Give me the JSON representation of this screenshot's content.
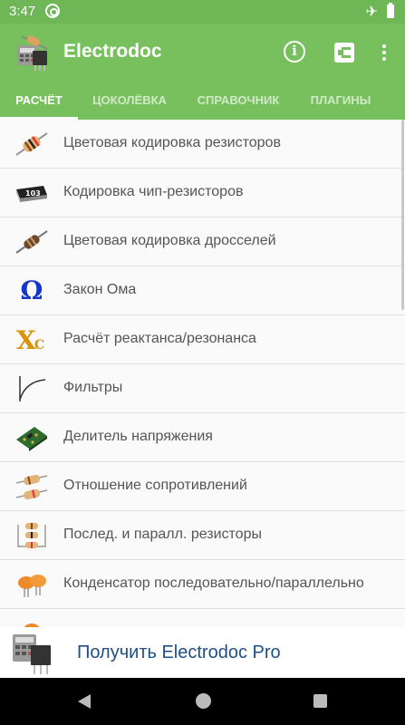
{
  "status_bar": {
    "time": "3:47"
  },
  "app": {
    "title": "Electrodoc"
  },
  "tabs": [
    {
      "label": "РАСЧЁТ",
      "active": true
    },
    {
      "label": "ЦОКОЛЁВКА",
      "active": false
    },
    {
      "label": "СПРАВОЧНИК",
      "active": false
    },
    {
      "label": "ПЛАГИНЫ",
      "active": false
    }
  ],
  "items": [
    {
      "label": "Цветовая кодировка резисторов",
      "icon": "resistor-icon"
    },
    {
      "label": "Кодировка чип-резисторов",
      "icon": "chip-resistor-icon"
    },
    {
      "label": "Цветовая кодировка дросселей",
      "icon": "inductor-icon"
    },
    {
      "label": "Закон Ома",
      "icon": "omega-icon",
      "glyph": "Ω"
    },
    {
      "label": "Расчёт реактанса/резонанса",
      "icon": "reactance-icon",
      "glyph": "X",
      "sub": "C"
    },
    {
      "label": "Фильтры",
      "icon": "filter-curve-icon"
    },
    {
      "label": "Делитель напряжения",
      "icon": "circuit-board-icon"
    },
    {
      "label": "Отношение сопротивлений",
      "icon": "resistors-ratio-icon"
    },
    {
      "label": "Послед. и паралл. резисторы",
      "icon": "resistor-network-icon"
    },
    {
      "label": "Конденсатор последовательно/параллельно",
      "icon": "capacitor-icon"
    }
  ],
  "chip_code": "103",
  "promo": {
    "label": "Получить Electrodoc Pro"
  },
  "colors": {
    "accent": "#78c05e",
    "status": "#6fb756",
    "promo_text": "#1f4f86"
  }
}
